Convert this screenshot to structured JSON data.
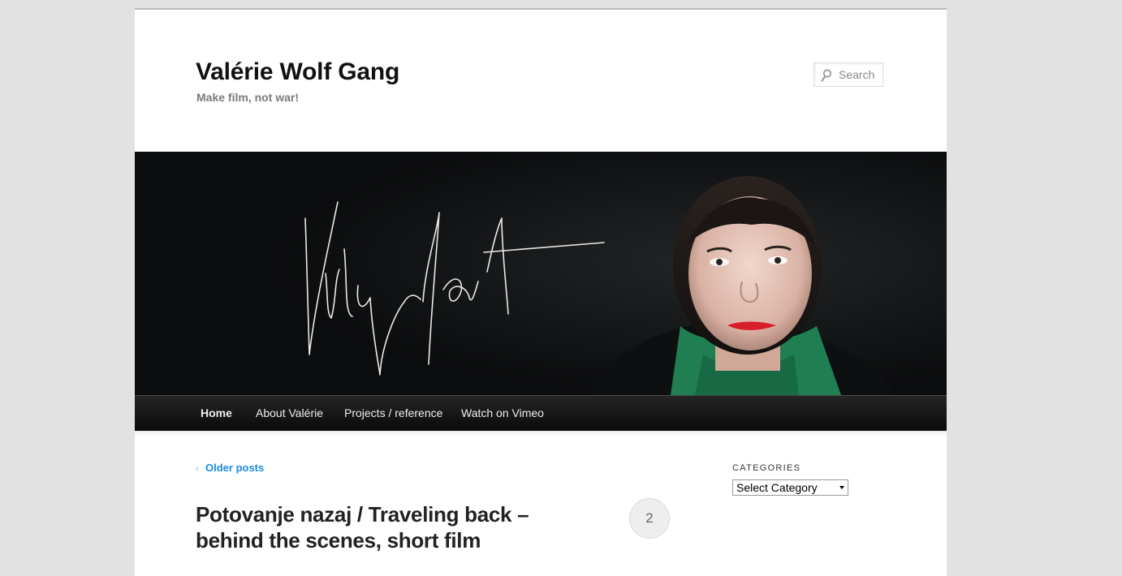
{
  "header": {
    "site_title": "Valérie Wolf Gang",
    "site_description": "Make film, not war!"
  },
  "search": {
    "placeholder": "Search",
    "icon": "magnifier-icon"
  },
  "header_image": {
    "signature_text": "Valérie Wolf Gang",
    "background_color": "#0c0d0e"
  },
  "nav": {
    "items": [
      {
        "label": "Home",
        "current": true
      },
      {
        "label": "About Valérie"
      },
      {
        "label": "Projects / reference"
      },
      {
        "label": "Watch on Vimeo"
      }
    ]
  },
  "content": {
    "older_posts_arrow": "‹",
    "older_posts_label": "Older posts",
    "post_title": "Potovanje nazaj / Traveling back – behind the scenes, short film",
    "comment_count": "2"
  },
  "sidebar": {
    "widget_title": "Categories",
    "select_value": "Select Category"
  },
  "colors": {
    "link": "#1b8be0",
    "page_bg": "#e2e2e2",
    "nav_bg": "#0a0a0a"
  }
}
